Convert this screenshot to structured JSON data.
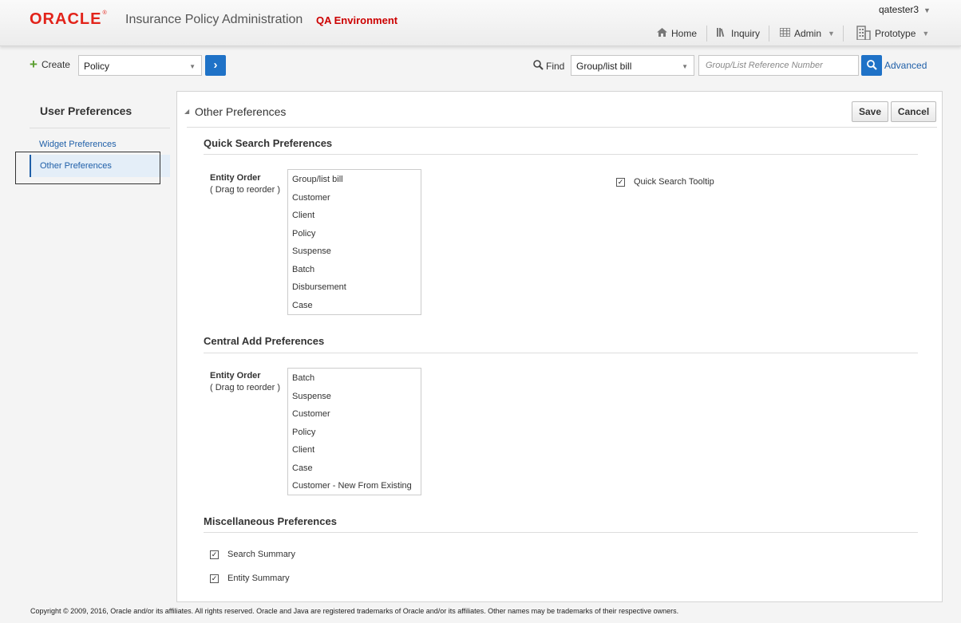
{
  "header": {
    "logo": "ORACLE",
    "logo_mark": "®",
    "app_title": "Insurance Policy Administration",
    "environment": "QA Environment",
    "user": "qatester3",
    "nav": {
      "home": "Home",
      "inquiry": "Inquiry",
      "admin": "Admin",
      "prototype": "Prototype"
    }
  },
  "toolbar": {
    "create_label": "Create",
    "create_select": "Policy",
    "find_label": "Find",
    "find_select": "Group/list bill",
    "reference_placeholder": "Group/List Reference Number",
    "advanced_link": "Advanced"
  },
  "sidebar": {
    "title": "User Preferences",
    "items": [
      {
        "label": "Widget Preferences",
        "selected": false
      },
      {
        "label": "Other Preferences",
        "selected": true
      }
    ]
  },
  "main": {
    "title": "Other Preferences",
    "save_label": "Save",
    "cancel_label": "Cancel",
    "quick_search": {
      "title": "Quick Search Preferences",
      "entity_label": "Entity Order",
      "drag_hint": "( Drag to reorder )",
      "items": [
        "Group/list bill",
        "Customer",
        "Client",
        "Policy",
        "Suspense",
        "Batch",
        "Disbursement",
        "Case"
      ],
      "tooltip_label": "Quick Search Tooltip",
      "tooltip_checked": true
    },
    "central_add": {
      "title": "Central Add Preferences",
      "entity_label": "Entity Order",
      "drag_hint": "( Drag to reorder )",
      "items": [
        "Batch",
        "Suspense",
        "Customer",
        "Policy",
        "Client",
        "Case",
        "Customer - New From Existing"
      ]
    },
    "misc": {
      "title": "Miscellaneous Preferences",
      "search_summary_label": "Search Summary",
      "search_summary_checked": true,
      "entity_summary_label": "Entity Summary",
      "entity_summary_checked": true
    }
  },
  "footer": {
    "copyright": "Copyright © 2009, 2016, Oracle and/or its affiliates. All rights reserved. Oracle and Java are registered trademarks of Oracle and/or its affiliates. Other names may be trademarks of their respective owners."
  },
  "colors": {
    "accent_blue": "#1f72c7",
    "link_blue": "#1f5fa8",
    "oracle_red": "#e2231a",
    "env_red": "#cc0000"
  }
}
